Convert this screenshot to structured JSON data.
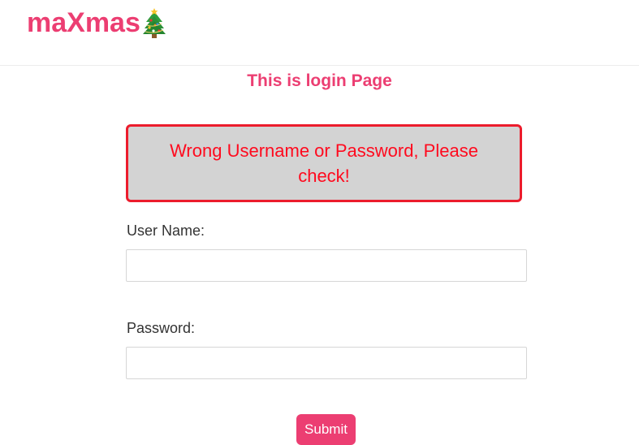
{
  "header": {
    "brand": "maXmas",
    "brand_icon": "christmas-tree-icon",
    "brand_color": "#ec3e72"
  },
  "main": {
    "title": "This is login Page",
    "error_message": "Wrong Username or Password, Please check!",
    "error_border_color": "#ec1c2c",
    "error_text_color": "#ff0a1e",
    "form": {
      "username_label": "User Name:",
      "username_value": "",
      "password_label": "Password:",
      "password_value": "",
      "submit_label": "Submit"
    }
  }
}
